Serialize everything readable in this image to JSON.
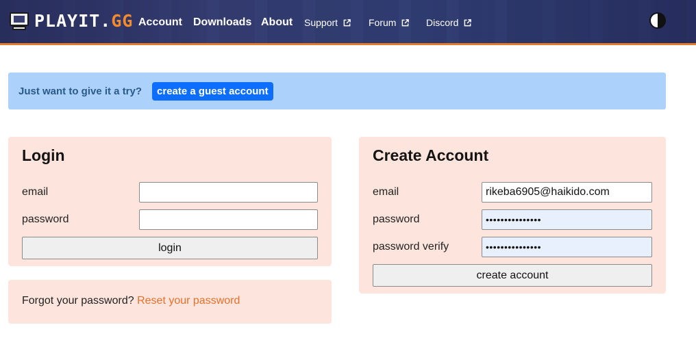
{
  "header": {
    "logo_text": "PLAYIT.",
    "logo_suffix": "GG",
    "nav": {
      "account": "Account",
      "downloads": "Downloads",
      "about": "About",
      "support": "Support",
      "forum": "Forum",
      "discord": "Discord"
    },
    "theme_icon": "contrast-icon",
    "accent_color": "#e57a2a"
  },
  "guest_banner": {
    "text": "Just want to give it a try?",
    "button_label": "create a guest account",
    "button_color": "#0d6efd",
    "background": "#acd2fc"
  },
  "login": {
    "title": "Login",
    "email_label": "email",
    "email_value": "",
    "password_label": "password",
    "password_value": "",
    "button_label": "login"
  },
  "forgot": {
    "text": "Forgot your password?",
    "link_label": "Reset your password"
  },
  "create_account": {
    "title": "Create Account",
    "email_label": "email",
    "email_value": "rikeba6905@haikido.com",
    "password_label": "password",
    "password_value": "•••••••••••••••",
    "password_verify_label": "password verify",
    "password_verify_value": "•••••••••••••••",
    "button_label": "create account"
  },
  "panel_color": "#fde4dc",
  "link_color": "#e8702a"
}
